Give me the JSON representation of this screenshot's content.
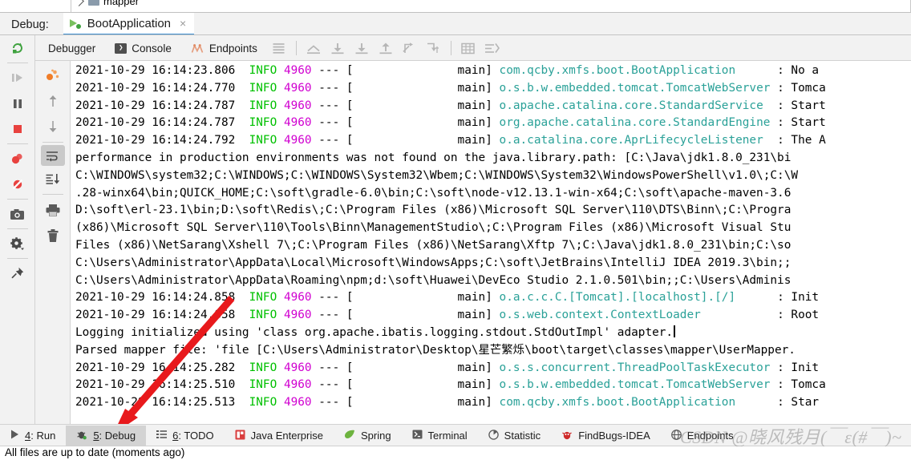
{
  "project_tree": {
    "visible_item": "mapper"
  },
  "debug_header": {
    "label": "Debug:",
    "tab_title": "BootApplication",
    "tab_close": "×",
    "run_icon": "run-with-debug-icon"
  },
  "subtoolbar": {
    "tabs": [
      {
        "label": "Debugger",
        "icon": null
      },
      {
        "label": "Console",
        "icon": "console-icon",
        "glyph": "❯"
      },
      {
        "label": "Endpoints",
        "icon": "endpoints-icon"
      }
    ],
    "buttons": [
      {
        "name": "soft-wrap-icon",
        "title": "Use Soft Wraps"
      },
      {
        "name": "scroll-up-icon",
        "title": "Scroll to Top"
      },
      {
        "name": "download-icon",
        "title": "Step Down"
      },
      {
        "name": "export-icon",
        "title": "Export"
      },
      {
        "name": "upload-icon",
        "title": "Scroll Up"
      },
      {
        "name": "step-out-icon",
        "title": "Step Out"
      },
      {
        "name": "step-into-icon",
        "title": "Step Into"
      },
      {
        "name": "table-icon",
        "title": "Table View"
      },
      {
        "name": "filter-lines-icon",
        "title": "Filter"
      }
    ]
  },
  "left_rail": [
    {
      "name": "resume-program-icon"
    },
    {
      "name": "pause-program-icon"
    },
    {
      "name": "stop-program-icon"
    },
    {
      "name": "view-breakpoints-icon"
    },
    {
      "name": "mute-breakpoints-icon"
    },
    {
      "name": "screenshot-icon"
    },
    {
      "name": "settings-gear-icon"
    },
    {
      "name": "pin-tab-icon"
    }
  ],
  "second_rail": [
    {
      "name": "threads-frames-icon"
    },
    {
      "name": "scroll-up-arrow-icon"
    },
    {
      "name": "scroll-down-arrow-icon"
    },
    {
      "name": "soft-wrap-lines-icon",
      "selected": true
    },
    {
      "name": "scroll-to-end-icon"
    },
    {
      "name": "print-icon"
    },
    {
      "name": "clear-all-icon"
    }
  ],
  "console": {
    "lines": [
      {
        "type": "log",
        "ts": "2021-10-29 16:14:23.806",
        "level": "INFO",
        "pid": "4960",
        "dash": "--- [",
        "thread": "main]",
        "logger": "com.qcby.xmfs.boot.BootApplication",
        "msg": ": No a"
      },
      {
        "type": "log",
        "ts": "2021-10-29 16:14:24.770",
        "level": "INFO",
        "pid": "4960",
        "dash": "--- [",
        "thread": "main]",
        "logger": "o.s.b.w.embedded.tomcat.TomcatWebServer",
        "msg": ": Tomca"
      },
      {
        "type": "log",
        "ts": "2021-10-29 16:14:24.787",
        "level": "INFO",
        "pid": "4960",
        "dash": "--- [",
        "thread": "main]",
        "logger": "o.apache.catalina.core.StandardService",
        "msg": ": Start"
      },
      {
        "type": "log",
        "ts": "2021-10-29 16:14:24.787",
        "level": "INFO",
        "pid": "4960",
        "dash": "--- [",
        "thread": "main]",
        "logger": "org.apache.catalina.core.StandardEngine",
        "msg": ": Start"
      },
      {
        "type": "log",
        "ts": "2021-10-29 16:14:24.792",
        "level": "INFO",
        "pid": "4960",
        "dash": "--- [",
        "thread": "main]",
        "logger": "o.a.catalina.core.AprLifecycleListener",
        "msg": ": The A"
      },
      {
        "type": "plain",
        "text": "performance in production environments was not found on the java.library.path: [C:\\Java\\jdk1.8.0_231\\bi"
      },
      {
        "type": "plain",
        "text": "C:\\WINDOWS\\system32;C:\\WINDOWS;C:\\WINDOWS\\System32\\Wbem;C:\\WINDOWS\\System32\\WindowsPowerShell\\v1.0\\;C:\\W"
      },
      {
        "type": "plain",
        "text": ".28-winx64\\bin;QUICK_HOME;C:\\soft\\gradle-6.0\\bin;C:\\soft\\node-v12.13.1-win-x64;C:\\soft\\apache-maven-3.6"
      },
      {
        "type": "plain",
        "text": "D:\\soft\\erl-23.1\\bin;D:\\soft\\Redis\\;C:\\Program Files (x86)\\Microsoft SQL Server\\110\\DTS\\Binn\\;C:\\Progra"
      },
      {
        "type": "plain",
        "text": "(x86)\\Microsoft SQL Server\\110\\Tools\\Binn\\ManagementStudio\\;C:\\Program Files (x86)\\Microsoft Visual Stu"
      },
      {
        "type": "plain",
        "text": "Files (x86)\\NetSarang\\Xshell 7\\;C:\\Program Files (x86)\\NetSarang\\Xftp 7\\;C:\\Java\\jdk1.8.0_231\\bin;C:\\so"
      },
      {
        "type": "plain",
        "text": "C:\\Users\\Administrator\\AppData\\Local\\Microsoft\\WindowsApps;C:\\soft\\JetBrains\\IntelliJ IDEA 2019.3\\bin;;"
      },
      {
        "type": "plain",
        "text": "C:\\Users\\Administrator\\AppData\\Roaming\\npm;d:\\soft\\Huawei\\DevEco Studio 2.1.0.501\\bin;;C:\\Users\\Adminis"
      },
      {
        "type": "log",
        "ts": "2021-10-29 16:14:24.858",
        "level": "INFO",
        "pid": "4960",
        "dash": "--- [",
        "thread": "main]",
        "logger": "o.a.c.c.C.[Tomcat].[localhost].[/]",
        "msg": ": Init"
      },
      {
        "type": "log",
        "ts": "2021-10-29 16:14:24.858",
        "level": "INFO",
        "pid": "4960",
        "dash": "--- [",
        "thread": "main]",
        "logger": "o.s.web.context.ContextLoader",
        "msg": ": Root"
      },
      {
        "type": "plain",
        "text": "Logging initialized using 'class org.apache.ibatis.logging.stdout.StdOutImpl' adapter.",
        "caret": true
      },
      {
        "type": "plain",
        "text": "Parsed mapper file: 'file [C:\\Users\\Administrator\\Desktop\\星芒繁烁\\boot\\target\\classes\\mapper\\UserMapper."
      },
      {
        "type": "log",
        "ts": "2021-10-29 16:14:25.282",
        "level": "INFO",
        "pid": "4960",
        "dash": "--- [",
        "thread": "main]",
        "logger": "o.s.s.concurrent.ThreadPoolTaskExecutor",
        "msg": ": Init"
      },
      {
        "type": "log",
        "ts": "2021-10-29 16:14:25.510",
        "level": "INFO",
        "pid": "4960",
        "dash": "--- [",
        "thread": "main]",
        "logger": "o.s.b.w.embedded.tomcat.TomcatWebServer",
        "msg": ": Tomca"
      },
      {
        "type": "log",
        "ts": "2021-10-29 16:14:25.513",
        "level": "INFO",
        "pid": "4960",
        "dash": "--- [",
        "thread": "main]",
        "logger": "com.qcby.xmfs.boot.BootApplication",
        "msg": ": Star"
      }
    ]
  },
  "bottom_bar": {
    "items": [
      {
        "num": "4",
        "label": ": Run",
        "icon": "run-icon",
        "active": false
      },
      {
        "num": "5",
        "label": ": Debug",
        "icon": "debug-bug-icon",
        "active": true
      },
      {
        "num": "6",
        "label": ": TODO",
        "icon": "todo-list-icon",
        "active": false
      },
      {
        "num": "",
        "label": "Java Enterprise",
        "icon": "java-enterprise-icon",
        "active": false
      },
      {
        "num": "",
        "label": "Spring",
        "icon": "spring-leaf-icon",
        "active": false
      },
      {
        "num": "",
        "label": "Terminal",
        "icon": "terminal-icon",
        "active": false
      },
      {
        "num": "",
        "label": "Statistic",
        "icon": "statistic-pie-icon",
        "active": false
      },
      {
        "num": "",
        "label": "FindBugs-IDEA",
        "icon": "findbugs-icon",
        "active": false
      },
      {
        "num": "",
        "label": "Endpoints",
        "icon": "globe-icon",
        "active": false
      }
    ]
  },
  "status_bar": {
    "text": "All files are up to date (moments ago)"
  },
  "watermark": {
    "text": "CSDN @晓风残月(￣ε(#￣)~"
  },
  "colors": {
    "info_green": "#00c000",
    "pid_magenta": "#d000d0",
    "logger_teal": "#2aa198",
    "tab_underline": "#3d8fd1",
    "arrow_red": "#e8191c",
    "panel_bg": "#f2f2f2"
  },
  "annotation": {
    "arrow": "red-arrow-pointing-to-debug-tab"
  }
}
